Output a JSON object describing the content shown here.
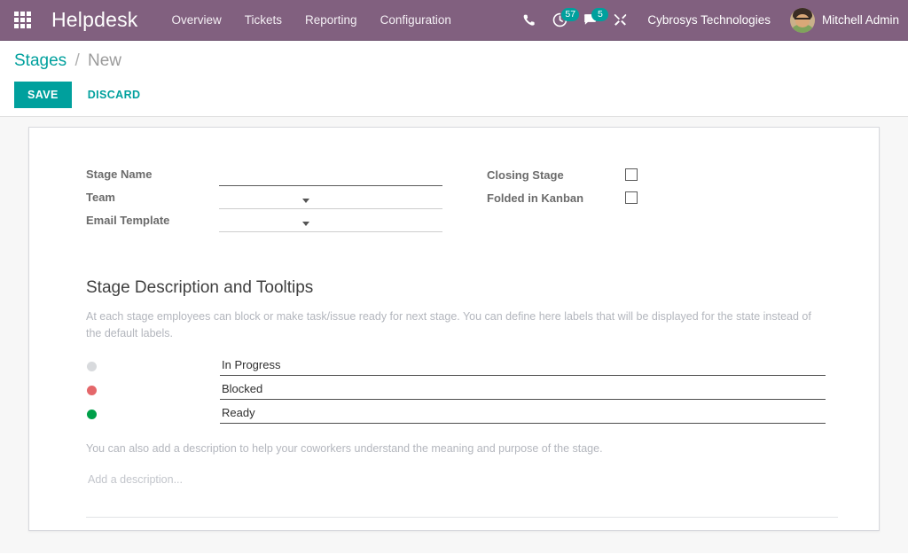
{
  "navbar": {
    "apps_icon": "apps-grid-icon",
    "brand": "Helpdesk",
    "menu": [
      {
        "label": "Overview"
      },
      {
        "label": "Tickets"
      },
      {
        "label": "Reporting"
      },
      {
        "label": "Configuration"
      }
    ],
    "icons": [
      {
        "name": "phone-icon",
        "badge": null
      },
      {
        "name": "activity-clock-icon",
        "badge": "57"
      },
      {
        "name": "messages-icon",
        "badge": "5"
      },
      {
        "name": "tools-icon",
        "badge": null
      }
    ],
    "company": "Cybrosys Technologies",
    "username": "Mitchell Admin",
    "avatar": "user-avatar"
  },
  "control_panel": {
    "breadcrumb": {
      "root": "Stages",
      "separator": "/",
      "current": "New"
    },
    "save_label": "SAVE",
    "discard_label": "DISCARD"
  },
  "form": {
    "stage_name": {
      "label": "Stage Name",
      "value": "",
      "placeholder": ""
    },
    "team": {
      "label": "Team",
      "value": "",
      "placeholder": ""
    },
    "email_template": {
      "label": "Email Template",
      "value": "",
      "placeholder": ""
    },
    "closing_stage": {
      "label": "Closing Stage",
      "checked": false
    },
    "folded_in_kanban": {
      "label": "Folded in Kanban",
      "checked": false
    }
  },
  "description_section": {
    "title": "Stage Description and Tooltips",
    "help_text": "At each stage employees can block or make task/issue ready for next stage. You can define here labels that will be displayed for the state instead of the default labels.",
    "legend": [
      {
        "color": "#d8dadd",
        "color_name": "grey",
        "value": "In Progress"
      },
      {
        "color": "#e4676a",
        "color_name": "red",
        "value": "Blocked"
      },
      {
        "color": "#00a04a",
        "color_name": "green",
        "value": "Ready"
      }
    ],
    "note_text": "You can also add a description to help your coworkers understand the meaning and purpose of the stage.",
    "description": {
      "value": "",
      "placeholder": "Add a description..."
    }
  },
  "theme": {
    "navbar_bg": "#81607f",
    "accent": "#00a09d",
    "page_bg": "#f7f7f7",
    "card_bg": "#ffffff"
  }
}
